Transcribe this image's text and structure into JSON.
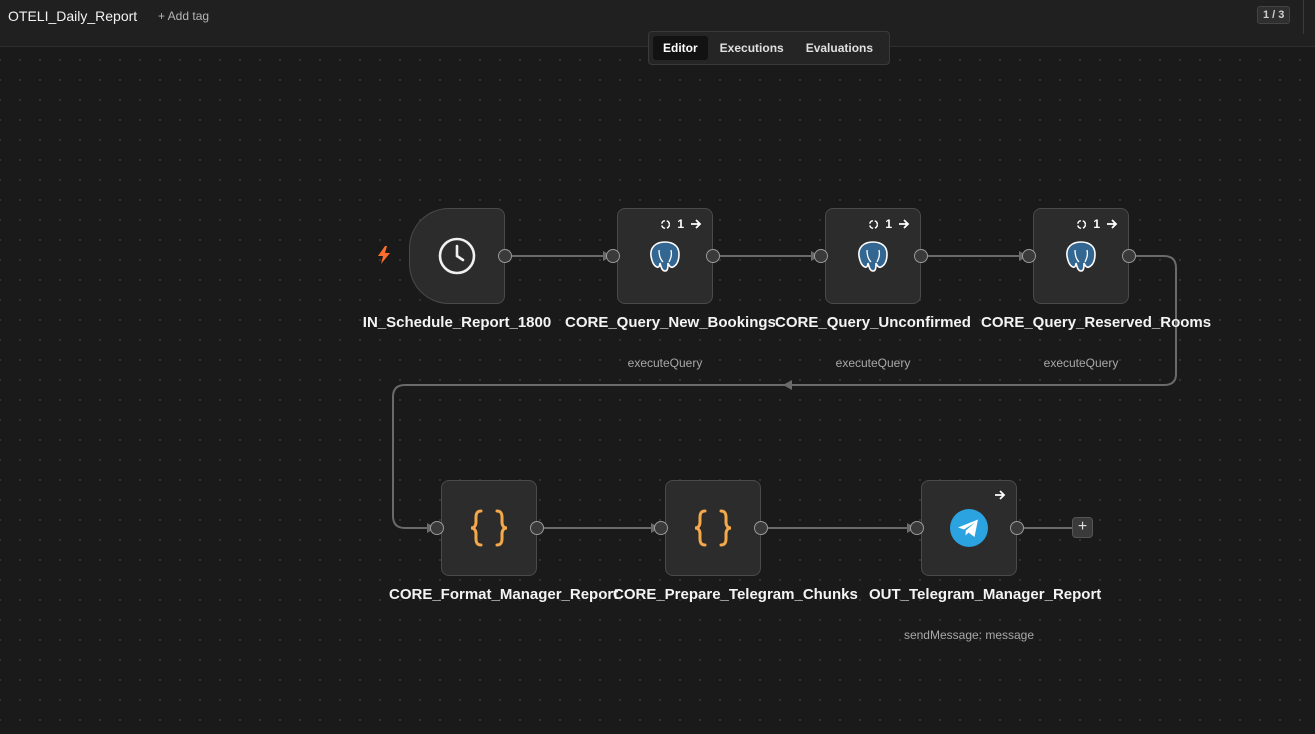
{
  "header": {
    "workflow_name": "OTELI_Daily_Report",
    "add_tag_label": "+ Add tag",
    "page_counter": "1 / 3"
  },
  "tabs": [
    {
      "label": "Editor",
      "active": true
    },
    {
      "label": "Executions",
      "active": false
    },
    {
      "label": "Evaluations",
      "active": false
    }
  ],
  "nodes": {
    "schedule": {
      "label": "IN_Schedule_Report_1800",
      "icon": "clock-icon"
    },
    "new_bookings": {
      "label": "CORE_Query_New_Bookings",
      "subtitle": "executeQuery",
      "icon": "postgres-icon",
      "badge_count": "1"
    },
    "unconfirmed": {
      "label": "CORE_Query_Unconfirmed",
      "subtitle": "executeQuery",
      "icon": "postgres-icon",
      "badge_count": "1"
    },
    "reserved_rooms": {
      "label": "CORE_Query_Reserved_Rooms",
      "subtitle": "executeQuery",
      "icon": "postgres-icon",
      "badge_count": "1"
    },
    "format_report": {
      "label": "CORE_Format_Manager_Report",
      "icon": "code-braces-icon"
    },
    "prepare_chunks": {
      "label": "CORE_Prepare_Telegram_Chunks",
      "icon": "code-braces-icon"
    },
    "telegram_out": {
      "label": "OUT_Telegram_Manager_Report",
      "subtitle": "sendMessage: message",
      "icon": "telegram-icon"
    }
  },
  "colors": {
    "trigger_bolt": "#ff6d2d",
    "code_braces": "#f6a94a",
    "telegram_blue": "#2aa3e0",
    "postgres_blue": "#336791"
  }
}
